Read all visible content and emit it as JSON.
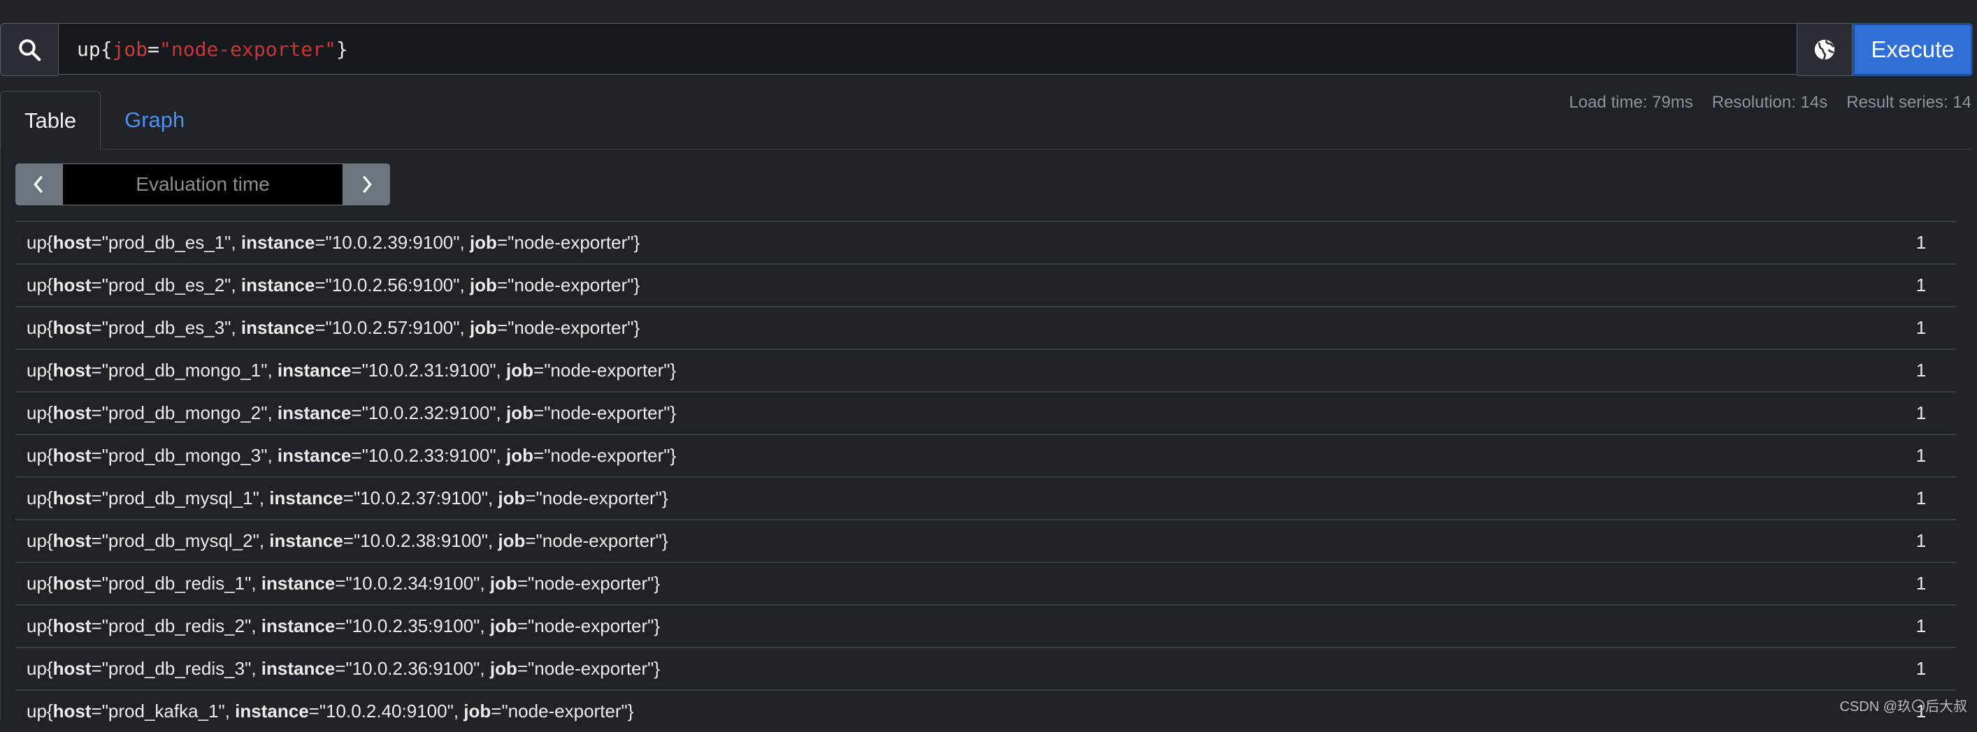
{
  "query": {
    "metric": "up",
    "label_name": "job",
    "label_value": "\"node-exporter\"",
    "open_brace": "{",
    "close_brace": "}",
    "equals": "=",
    "execute_label": "Execute"
  },
  "tabs": [
    {
      "label": "Table",
      "active": true
    },
    {
      "label": "Graph",
      "active": false
    }
  ],
  "stats": {
    "load_time": "Load time: 79ms",
    "resolution": "Resolution: 14s",
    "result_series": "Result series: 14"
  },
  "eval_time": {
    "placeholder": "Evaluation time"
  },
  "results": [
    {
      "host": "\"prod_db_es_1\"",
      "instance": "\"10.0.2.39:9100\"",
      "job": "\"node-exporter\"",
      "value": "1"
    },
    {
      "host": "\"prod_db_es_2\"",
      "instance": "\"10.0.2.56:9100\"",
      "job": "\"node-exporter\"",
      "value": "1"
    },
    {
      "host": "\"prod_db_es_3\"",
      "instance": "\"10.0.2.57:9100\"",
      "job": "\"node-exporter\"",
      "value": "1"
    },
    {
      "host": "\"prod_db_mongo_1\"",
      "instance": "\"10.0.2.31:9100\"",
      "job": "\"node-exporter\"",
      "value": "1"
    },
    {
      "host": "\"prod_db_mongo_2\"",
      "instance": "\"10.0.2.32:9100\"",
      "job": "\"node-exporter\"",
      "value": "1"
    },
    {
      "host": "\"prod_db_mongo_3\"",
      "instance": "\"10.0.2.33:9100\"",
      "job": "\"node-exporter\"",
      "value": "1"
    },
    {
      "host": "\"prod_db_mysql_1\"",
      "instance": "\"10.0.2.37:9100\"",
      "job": "\"node-exporter\"",
      "value": "1"
    },
    {
      "host": "\"prod_db_mysql_2\"",
      "instance": "\"10.0.2.38:9100\"",
      "job": "\"node-exporter\"",
      "value": "1"
    },
    {
      "host": "\"prod_db_redis_1\"",
      "instance": "\"10.0.2.34:9100\"",
      "job": "\"node-exporter\"",
      "value": "1"
    },
    {
      "host": "\"prod_db_redis_2\"",
      "instance": "\"10.0.2.35:9100\"",
      "job": "\"node-exporter\"",
      "value": "1"
    },
    {
      "host": "\"prod_db_redis_3\"",
      "instance": "\"10.0.2.36:9100\"",
      "job": "\"node-exporter\"",
      "value": "1"
    },
    {
      "host": "\"prod_kafka_1\"",
      "instance": "\"10.0.2.40:9100\"",
      "job": "\"node-exporter\"",
      "value": "1"
    }
  ],
  "result_labels": {
    "metric": "up",
    "host_key": "host",
    "instance_key": "instance",
    "job_key": "job"
  },
  "watermark": "CSDN @玖〇后大叔",
  "colors": {
    "accent": "#2f6fd6",
    "link": "#4d8ff0",
    "label_red": "#d23a3a"
  },
  "icons": {
    "search": "search-icon",
    "globe": "globe-icon",
    "prev": "chevron-left-icon",
    "next": "chevron-right-icon"
  }
}
